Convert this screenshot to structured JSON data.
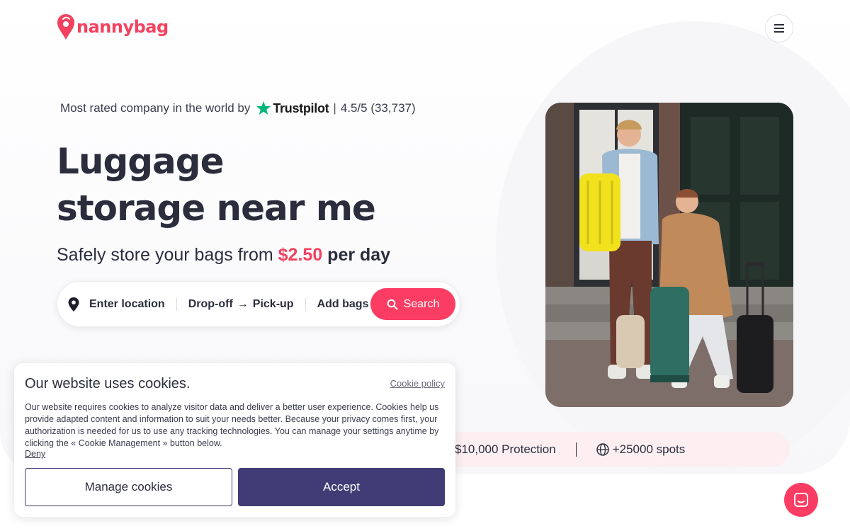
{
  "brand": {
    "name": "nannybag",
    "color": "#f2425f"
  },
  "header": {
    "menu_icon": "hamburger-icon"
  },
  "trust": {
    "prefix": "Most rated company in the world by",
    "provider": "Trustpilot",
    "separator": "|",
    "rating": "4.5/5 (33,737)"
  },
  "hero": {
    "headline_line1": "Luggage",
    "headline_line2": "storage near me",
    "sub_prefix": "Safely store your bags from",
    "price": "$2.50",
    "sub_suffix": "per day"
  },
  "search": {
    "location_placeholder": "Enter location",
    "dropoff": "Drop-off",
    "arrow": "→",
    "pickup": "Pick-up",
    "bags": "Add bags",
    "button_label": "Search",
    "accent": "#fc3d63"
  },
  "features": {
    "protection": "$10,000 Protection",
    "spots": "+25000 spots"
  },
  "cookie": {
    "title": "Our website uses cookies.",
    "policy_link": "Cookie policy",
    "body": "Our website requires cookies to analyze visitor data and deliver a better user experience. Cookies help us provide adapted content and information to suit your needs better. Because your privacy comes first, your authorization is needed for us to use any tracking technologies. You can manage your settings anytime by clicking the « Cookie Management » button below.",
    "deny": "Deny",
    "manage_label": "Manage cookies",
    "accept_label": "Accept",
    "accept_color": "#413c75"
  },
  "chat": {
    "icon": "chat-icon"
  }
}
